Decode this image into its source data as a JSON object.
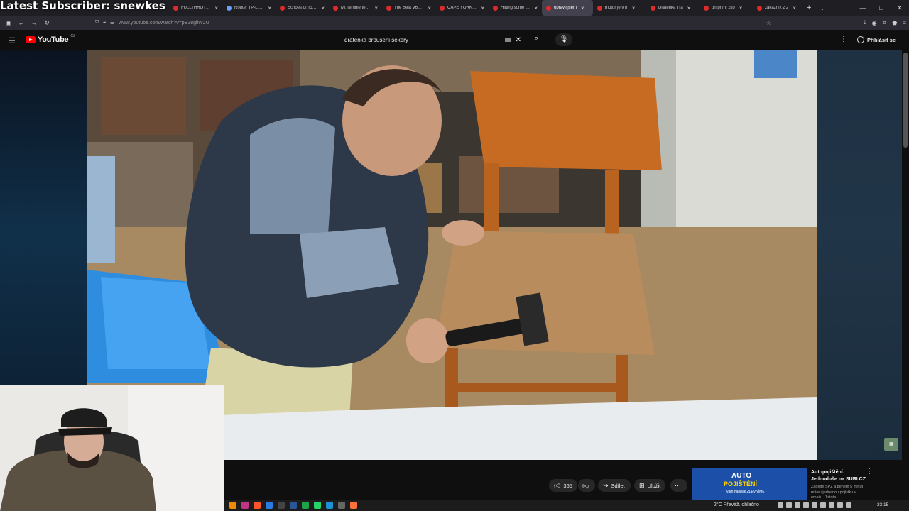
{
  "overlay": {
    "title": "Latest Subscriber: snewkes"
  },
  "browser": {
    "tabs": [
      {
        "label": "FULLTHROTTLERi",
        "icon": "youtube-icon"
      },
      {
        "label": "Router TP-Link Ti",
        "icon": "browser-tab-icon"
      },
      {
        "label": "Echoes of Tomor",
        "icon": "pinterest-icon"
      },
      {
        "label": "Mt Terrible tests",
        "icon": "youtube-icon"
      },
      {
        "label": "The Best V62 Nis",
        "icon": "youtube-icon"
      },
      {
        "label": "CAPE YORK TELE",
        "icon": "youtube-icon"
      },
      {
        "label": "Hitting some ga",
        "icon": "youtube-icon"
      },
      {
        "label": "opravil jsem",
        "icon": "speaker-icon",
        "active": true
      },
      {
        "label": "motor je v tr",
        "icon": "youtube-icon"
      },
      {
        "label": "Drátěnka Tra",
        "icon": "youtube-icon"
      },
      {
        "label": "při první zko",
        "icon": "youtube-icon"
      },
      {
        "label": "zákazník z 2",
        "icon": "youtube-icon"
      }
    ],
    "url": "www.youtube.com/watch?v=pB38gilW2U"
  },
  "youtube": {
    "logo_text": "YouTube",
    "region": "CZ",
    "search_query": "dratenka brouseni sekery",
    "signin_label": "Přihlásit se"
  },
  "actions": {
    "like_count": "365",
    "share_label": "Sdílet",
    "save_label": "Uložit"
  },
  "ad": {
    "thumb_line1": "AUTO",
    "thumb_line2": "POJIŠTĚNÍ",
    "thumb_line3": "vám naopak ZLEVNÍME",
    "title_line1": "Autopojištění.",
    "title_line2": "Jednoduše na SURI.CZ",
    "body": "Zadejte SPZ a během 5 minut máte sjednanou pojistku v emailu. Jistota..."
  },
  "taskbar": {
    "weather": "2°C  Převáž. oblačno",
    "time": "23:15"
  },
  "colors": {
    "youtube_red": "#ff0000",
    "tab_bar": "#1f1f23",
    "page_bg": "#0f0f0f"
  }
}
